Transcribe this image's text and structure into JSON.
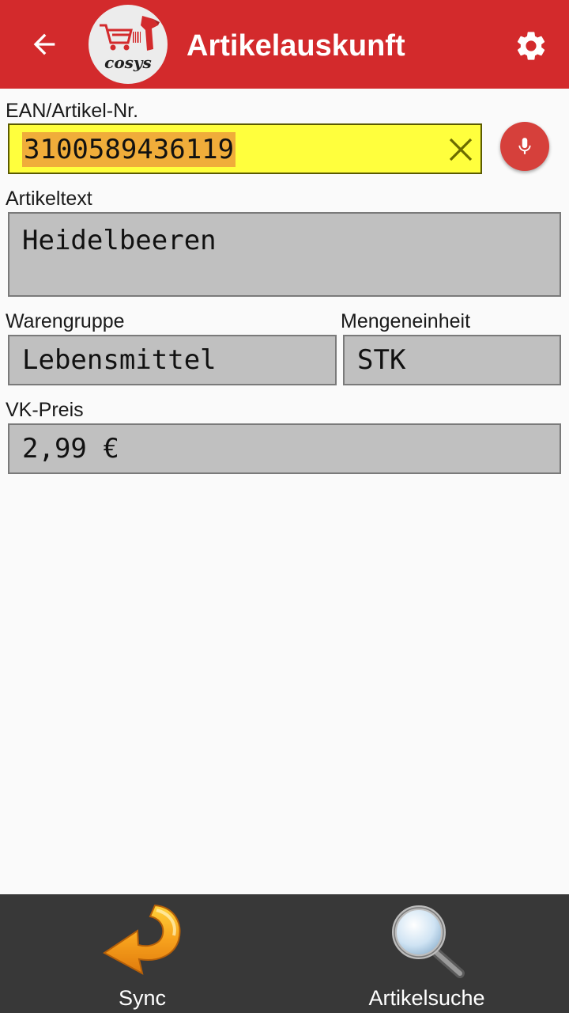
{
  "appbar": {
    "title": "Artikelauskunft",
    "back_icon": "arrow-left-icon",
    "settings_icon": "gear-icon",
    "logo_text": "cosys",
    "color": "#d32a2c"
  },
  "form": {
    "ean": {
      "label": "EAN/Artikel-Nr.",
      "value": "3100589436119",
      "clear_icon": "close-icon",
      "mic_icon": "microphone-icon"
    },
    "artikeltext": {
      "label": "Artikeltext",
      "value": "Heidelbeeren"
    },
    "warengruppe": {
      "label": "Warengruppe",
      "value": "Lebensmittel"
    },
    "mengeneinheit": {
      "label": "Mengeneinheit",
      "value": "STK"
    },
    "vk_preis": {
      "label": "VK-Preis",
      "value": "2,99 €"
    }
  },
  "bottom_nav": {
    "sync": {
      "label": "Sync",
      "icon": "sync-arrow-icon"
    },
    "artikelsuche": {
      "label": "Artikelsuche",
      "icon": "magnifier-icon"
    }
  }
}
